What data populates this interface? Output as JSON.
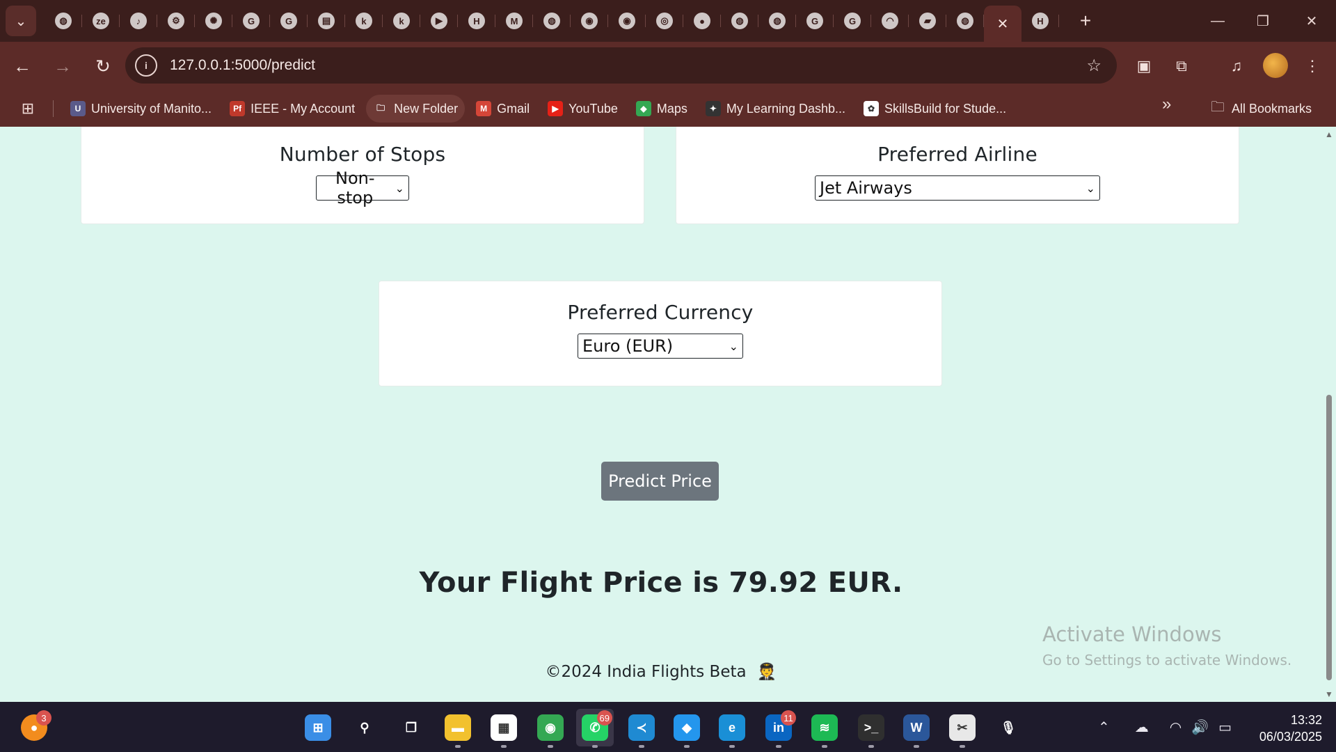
{
  "browser": {
    "url": "127.0.0.1:5000/predict",
    "tabs": [
      {
        "icon": "globe-icon",
        "glyph": "◍"
      },
      {
        "icon": "zeta-icon",
        "glyph": "ze"
      },
      {
        "icon": "moodle-icon",
        "glyph": "♪"
      },
      {
        "icon": "settings-icon",
        "glyph": "⚙"
      },
      {
        "icon": "openai-icon",
        "glyph": "✺"
      },
      {
        "icon": "google-icon",
        "glyph": "G"
      },
      {
        "icon": "google-icon",
        "glyph": "G"
      },
      {
        "icon": "database-icon",
        "glyph": "▤"
      },
      {
        "icon": "kaggle-icon",
        "glyph": "k"
      },
      {
        "icon": "kaggle-icon",
        "glyph": "k"
      },
      {
        "icon": "youtube-icon",
        "glyph": "▶"
      },
      {
        "icon": "hackmd-icon",
        "glyph": "H"
      },
      {
        "icon": "gmail-icon",
        "glyph": "M"
      },
      {
        "icon": "globe-icon",
        "glyph": "◍"
      },
      {
        "icon": "github-icon",
        "glyph": "◉"
      },
      {
        "icon": "github-icon",
        "glyph": "◉"
      },
      {
        "icon": "chrome-icon",
        "glyph": "◎"
      },
      {
        "icon": "blank-icon",
        "glyph": "●"
      },
      {
        "icon": "globe-icon",
        "glyph": "◍"
      },
      {
        "icon": "globe-icon",
        "glyph": "◍"
      },
      {
        "icon": "google-icon",
        "glyph": "G"
      },
      {
        "icon": "google-icon",
        "glyph": "G"
      },
      {
        "icon": "jupyter-icon",
        "glyph": "◠"
      },
      {
        "icon": "notebook-icon",
        "glyph": "▰"
      },
      {
        "icon": "globe-icon",
        "glyph": "◍"
      },
      {
        "icon": "hackmd-icon",
        "glyph": "H"
      }
    ],
    "bookmarks": [
      {
        "label": "University of Manito...",
        "color": "#5a5a8a",
        "glyph": "U"
      },
      {
        "label": "IEEE - My Account",
        "color": "#c0392b",
        "glyph": "Pf"
      },
      {
        "label": "New Folder",
        "color": "transparent",
        "glyph": "🗀"
      },
      {
        "label": "Gmail",
        "color": "#d44638",
        "glyph": "M"
      },
      {
        "label": "YouTube",
        "color": "#e62117",
        "glyph": "▶"
      },
      {
        "label": "Maps",
        "color": "#34a853",
        "glyph": "◆"
      },
      {
        "label": "My Learning Dashb...",
        "color": "#333",
        "glyph": "✦"
      },
      {
        "label": "SkillsBuild for Stude...",
        "color": "#ffffff",
        "glyph": "✿"
      }
    ],
    "all_bookmarks_label": "All Bookmarks"
  },
  "form": {
    "stops": {
      "label": "Number of Stops",
      "selected": "Non-stop"
    },
    "airline": {
      "label": "Preferred Airline",
      "selected": "Jet Airways"
    },
    "currency": {
      "label": "Preferred Currency",
      "selected": "Euro (EUR)"
    },
    "submit_label": "Predict Price"
  },
  "result_text": "Your Flight Price is 79.92 EUR.",
  "footer_text": "©2024 India Flights Beta",
  "watermark": {
    "title": "Activate Windows",
    "subtitle": "Go to Settings to activate Windows."
  },
  "taskbar": {
    "apps": [
      {
        "name": "start-button",
        "color": "#3a8ee6",
        "glyph": "⊞"
      },
      {
        "name": "search-icon",
        "color": "transparent",
        "glyph": "⚲"
      },
      {
        "name": "task-view-icon",
        "color": "transparent",
        "glyph": "❐"
      },
      {
        "name": "file-explorer-icon",
        "color": "#f2c12e",
        "glyph": "▬"
      },
      {
        "name": "store-icon",
        "color": "#ffffff",
        "glyph": "▦"
      },
      {
        "name": "chrome-icon",
        "color": "#34a853",
        "glyph": "◉"
      },
      {
        "name": "whatsapp-icon",
        "color": "#25d366",
        "glyph": "✆",
        "badge": "69"
      },
      {
        "name": "vscode-icon",
        "color": "#1f8ad2",
        "glyph": "≺"
      },
      {
        "name": "docker-icon",
        "color": "#2496ed",
        "glyph": "◆"
      },
      {
        "name": "edge-icon",
        "color": "#1a8fd6",
        "glyph": "e"
      },
      {
        "name": "linkedin-icon",
        "color": "#0a66c2",
        "glyph": "in",
        "badge": "11"
      },
      {
        "name": "spotify-icon",
        "color": "#1db954",
        "glyph": "≋"
      },
      {
        "name": "terminal-icon",
        "color": "#2f2f2f",
        "glyph": ">_"
      },
      {
        "name": "word-icon",
        "color": "#2b579a",
        "glyph": "W"
      },
      {
        "name": "snipping-tool-icon",
        "color": "#e8e8e8",
        "glyph": "✂"
      },
      {
        "name": "microphone-icon",
        "color": "transparent",
        "glyph": "🎙"
      }
    ],
    "notification_badge": "3",
    "time": "13:32",
    "date": "06/03/2025"
  }
}
